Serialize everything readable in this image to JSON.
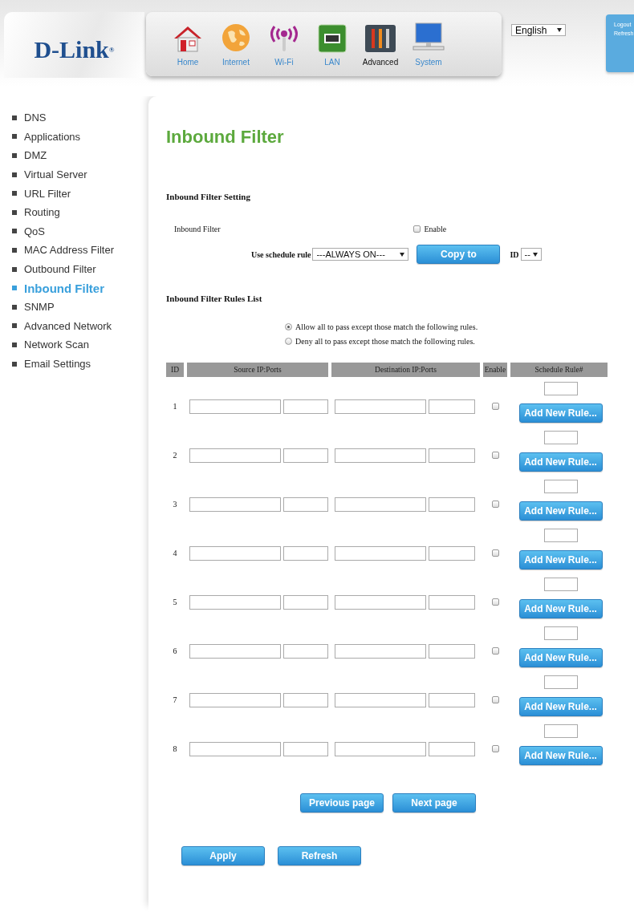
{
  "header": {
    "logo": "D-Link$^{®}$",
    "nav": [
      {
        "label": "Home",
        "kind": "home",
        "selected": false
      },
      {
        "label": "Internet",
        "kind": "globe",
        "selected": false
      },
      {
        "label": "Wi-Fi",
        "kind": "wifi",
        "selected": false
      },
      {
        "label": "LAN",
        "kind": "lan",
        "selected": false
      },
      {
        "label": "Advanced",
        "kind": "tools",
        "selected": true
      },
      {
        "label": "System",
        "kind": "monitor",
        "selected": false
      }
    ],
    "language": "English",
    "links": [
      "Logout",
      "Refresh"
    ]
  },
  "sidebar": {
    "items": [
      {
        "label": "DNS",
        "selected": false
      },
      {
        "label": "Applications",
        "selected": false
      },
      {
        "label": "DMZ",
        "selected": false
      },
      {
        "label": "Virtual Server",
        "selected": false
      },
      {
        "label": "URL Filter",
        "selected": false
      },
      {
        "label": "Routing",
        "selected": false
      },
      {
        "label": "QoS",
        "selected": false
      },
      {
        "label": "MAC Address Filter",
        "selected": false
      },
      {
        "label": "Outbound Filter",
        "selected": false
      },
      {
        "label": "Inbound Filter",
        "selected": true
      },
      {
        "label": "SNMP",
        "selected": false
      },
      {
        "label": "Advanced Network",
        "selected": false
      },
      {
        "label": "Network Scan",
        "selected": false
      },
      {
        "label": "Email Settings",
        "selected": false
      }
    ]
  },
  "title": "Inbound Filter",
  "setting": {
    "heading": "Inbound Filter Setting",
    "filter_label": "Inbound Filter",
    "enable": {
      "label": "Enable",
      "checked": false
    },
    "schedule_label": "Use schedule rule",
    "schedule_value": "---ALWAYS ON---",
    "copy_button": "Copy to",
    "id_label": "ID",
    "id_value": "--"
  },
  "rules_list": {
    "heading": "Inbound Filter Rules List",
    "modes": [
      {
        "label": "Allow all to pass except those match the following rules.",
        "selected": true
      },
      {
        "label": "Deny all to pass except those match the following rules.",
        "selected": false
      }
    ]
  },
  "table": {
    "columns": [
      "ID",
      "Source IP:Ports",
      "Destination IP:Ports",
      "Enable",
      "Schedule Rule#"
    ],
    "rows": [
      {
        "id": "1",
        "enabled": false,
        "button": "Add New Rule..."
      },
      {
        "id": "2",
        "enabled": false,
        "button": "Add New Rule..."
      },
      {
        "id": "3",
        "enabled": false,
        "button": "Add New Rule..."
      },
      {
        "id": "4",
        "enabled": false,
        "button": "Add New Rule..."
      },
      {
        "id": "5",
        "enabled": false,
        "button": "Add New Rule..."
      },
      {
        "id": "6",
        "enabled": false,
        "button": "Add New Rule..."
      },
      {
        "id": "7",
        "enabled": false,
        "button": "Add New Rule..."
      },
      {
        "id": "8",
        "enabled": false,
        "button": "Add New Rule..."
      }
    ]
  },
  "pager": [
    "Previous page",
    "Next page"
  ],
  "actions": [
    "Apply",
    "Refresh"
  ]
}
